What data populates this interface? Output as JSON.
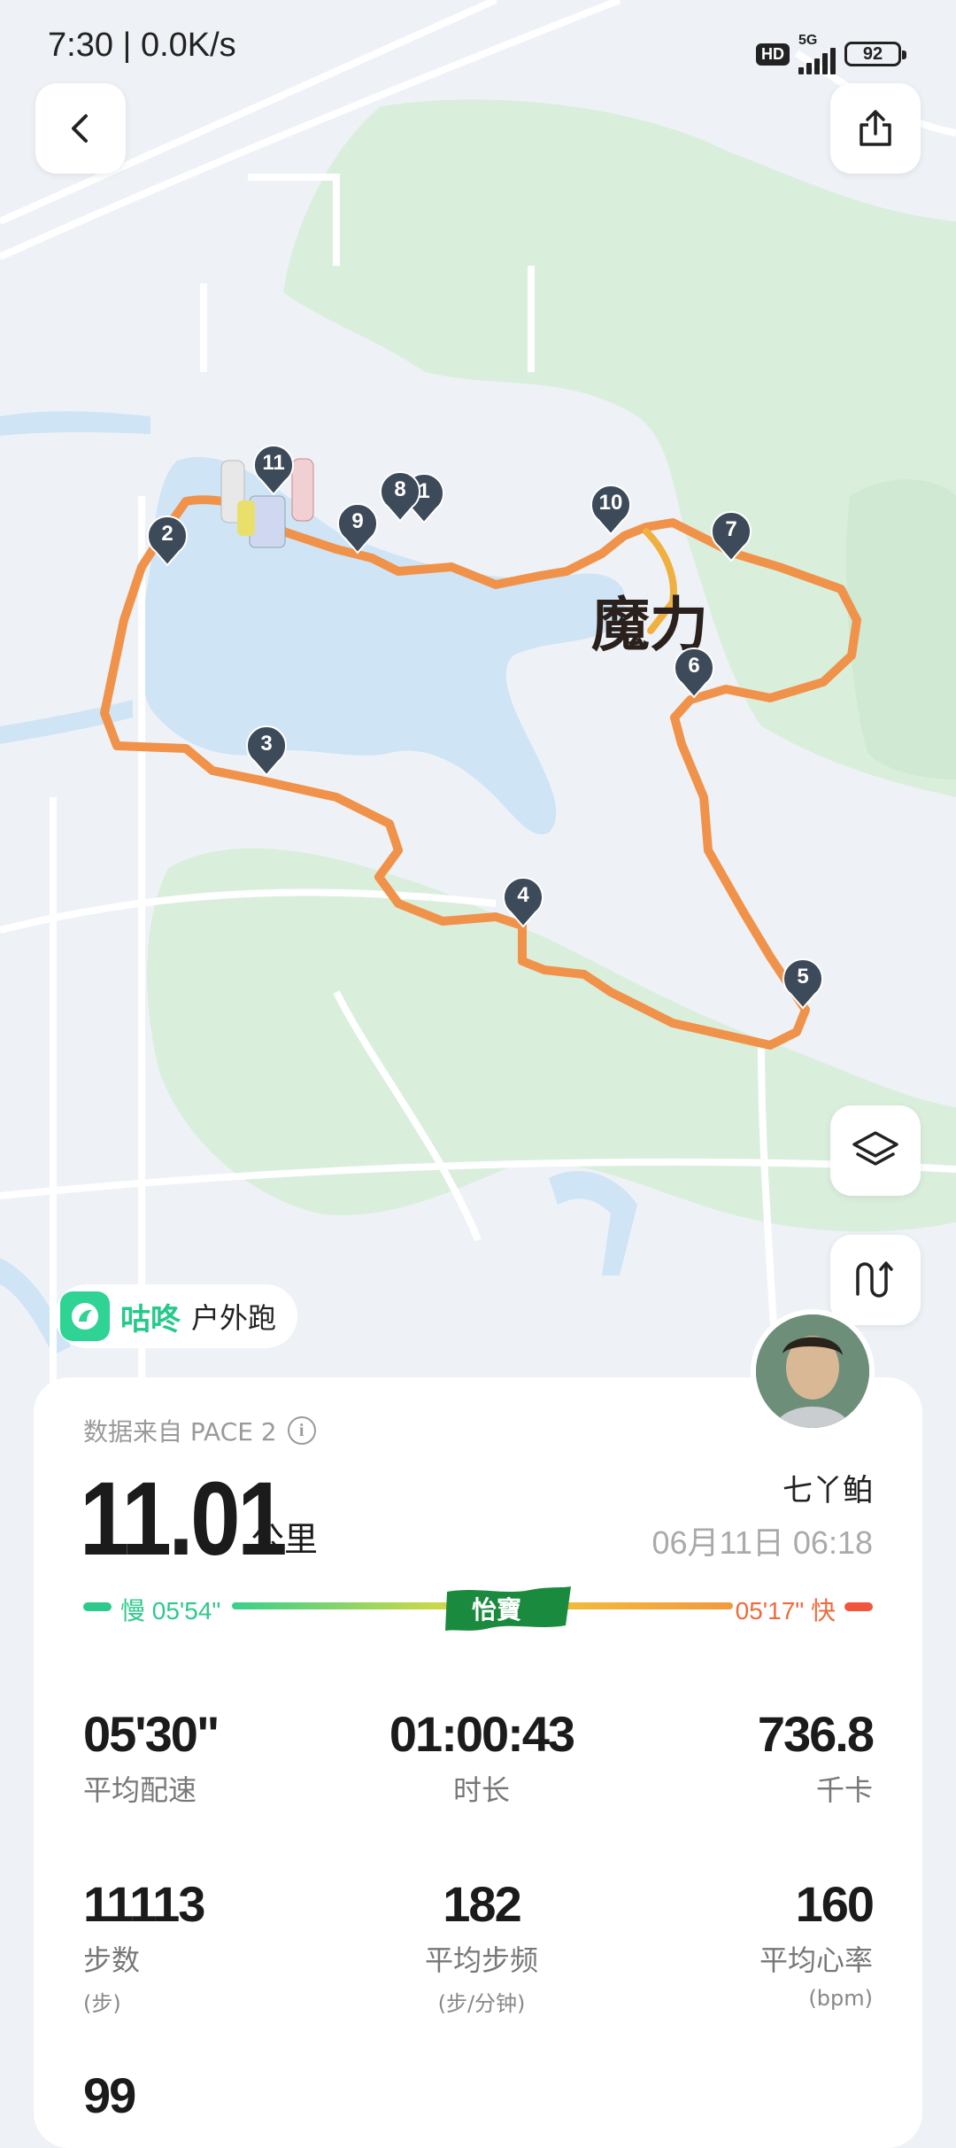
{
  "status_bar": {
    "time": "7:30 | 0.0K/s",
    "hd": "HD",
    "network": "5G",
    "battery": "92"
  },
  "map": {
    "label": "魔力",
    "route_color": "#f0924a",
    "markers": [
      "1",
      "2",
      "3",
      "4",
      "5",
      "6",
      "7",
      "8",
      "9",
      "10",
      "11"
    ]
  },
  "source_chip": {
    "brand": "咕咚",
    "activity": "户外跑"
  },
  "summary": {
    "data_source": "数据来自 PACE 2",
    "distance": "11.01",
    "distance_unit": "公里",
    "user_name": "七丫鲌",
    "datetime": "06月11日 06:18",
    "pace_slow": "慢 05'54\"",
    "pace_fast": "05'17\" 快",
    "sponsor": "怡寶"
  },
  "stats": [
    {
      "value": "05'30\"",
      "label": "平均配速",
      "sub": ""
    },
    {
      "value": "01:00:43",
      "label": "时长",
      "sub": ""
    },
    {
      "value": "736.8",
      "label": "千卡",
      "sub": ""
    },
    {
      "value": "11113",
      "label": "步数",
      "sub": "(步)"
    },
    {
      "value": "182",
      "label": "平均步频",
      "sub": "(步/分钟)"
    },
    {
      "value": "160",
      "label": "平均心率",
      "sub": "(bpm)"
    },
    {
      "value": "99",
      "label": "",
      "sub": ""
    }
  ],
  "colors": {
    "green_accent": "#2ec98c",
    "fast_accent": "#f0563c",
    "marker": "#3d4a59"
  }
}
